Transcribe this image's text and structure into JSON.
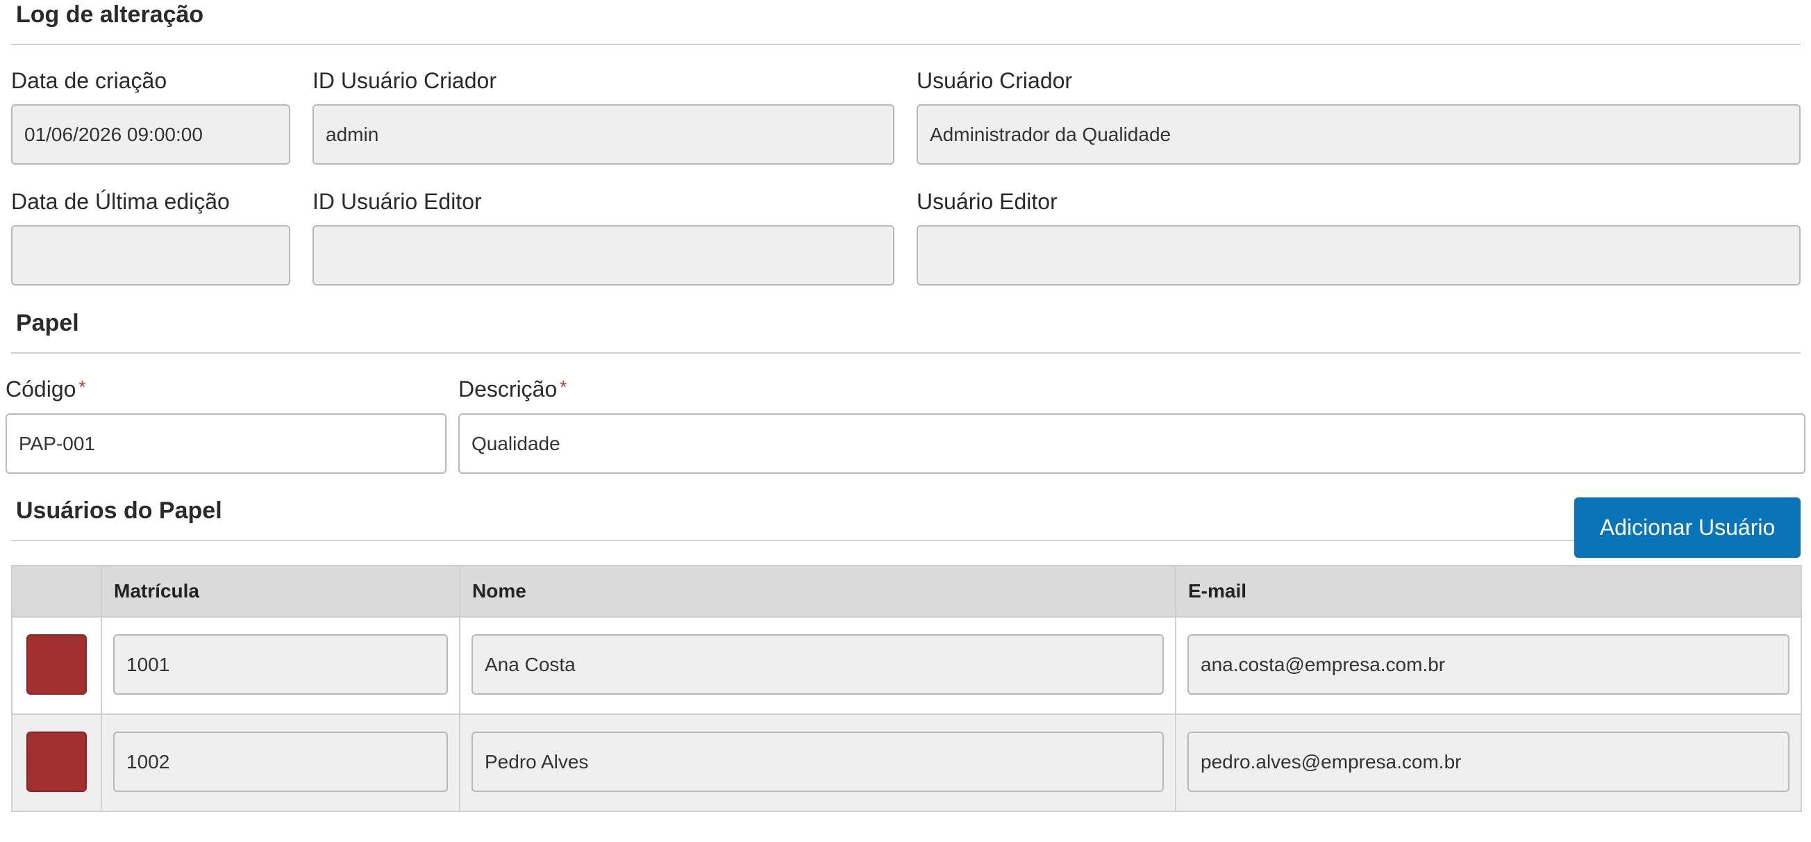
{
  "log": {
    "title": "Log de alteração",
    "created_date_label": "Data de criação",
    "created_date_value": "01/06/2026 09:00:00",
    "creator_id_label": "ID Usuário Criador",
    "creator_id_value": "admin",
    "creator_user_label": "Usuário Criador",
    "creator_user_value": "Administrador da Qualidade",
    "last_edit_label": "Data de Última edição",
    "last_edit_value": "",
    "editor_id_label": "ID Usuário Editor",
    "editor_id_value": "",
    "editor_user_label": "Usuário Editor",
    "editor_user_value": ""
  },
  "role": {
    "title": "Papel",
    "code_label": "Código",
    "code_value": "PAP-001",
    "description_label": "Descrição",
    "description_value": "Qualidade",
    "required_mark": "*"
  },
  "users": {
    "title": "Usuários do Papel",
    "add_button": "Adicionar Usuário",
    "columns": [
      "",
      "Matrícula",
      "Nome",
      "E-mail"
    ],
    "rows": [
      {
        "matricula": "1001",
        "nome": "Ana Costa",
        "email": "ana.costa@empresa.com.br"
      },
      {
        "matricula": "1002",
        "nome": "Pedro Alves",
        "email": "pedro.alves@empresa.com.br"
      }
    ]
  },
  "colors": {
    "primary": "#0a74b8",
    "delete": "#a1302e",
    "required": "#c0392b"
  }
}
